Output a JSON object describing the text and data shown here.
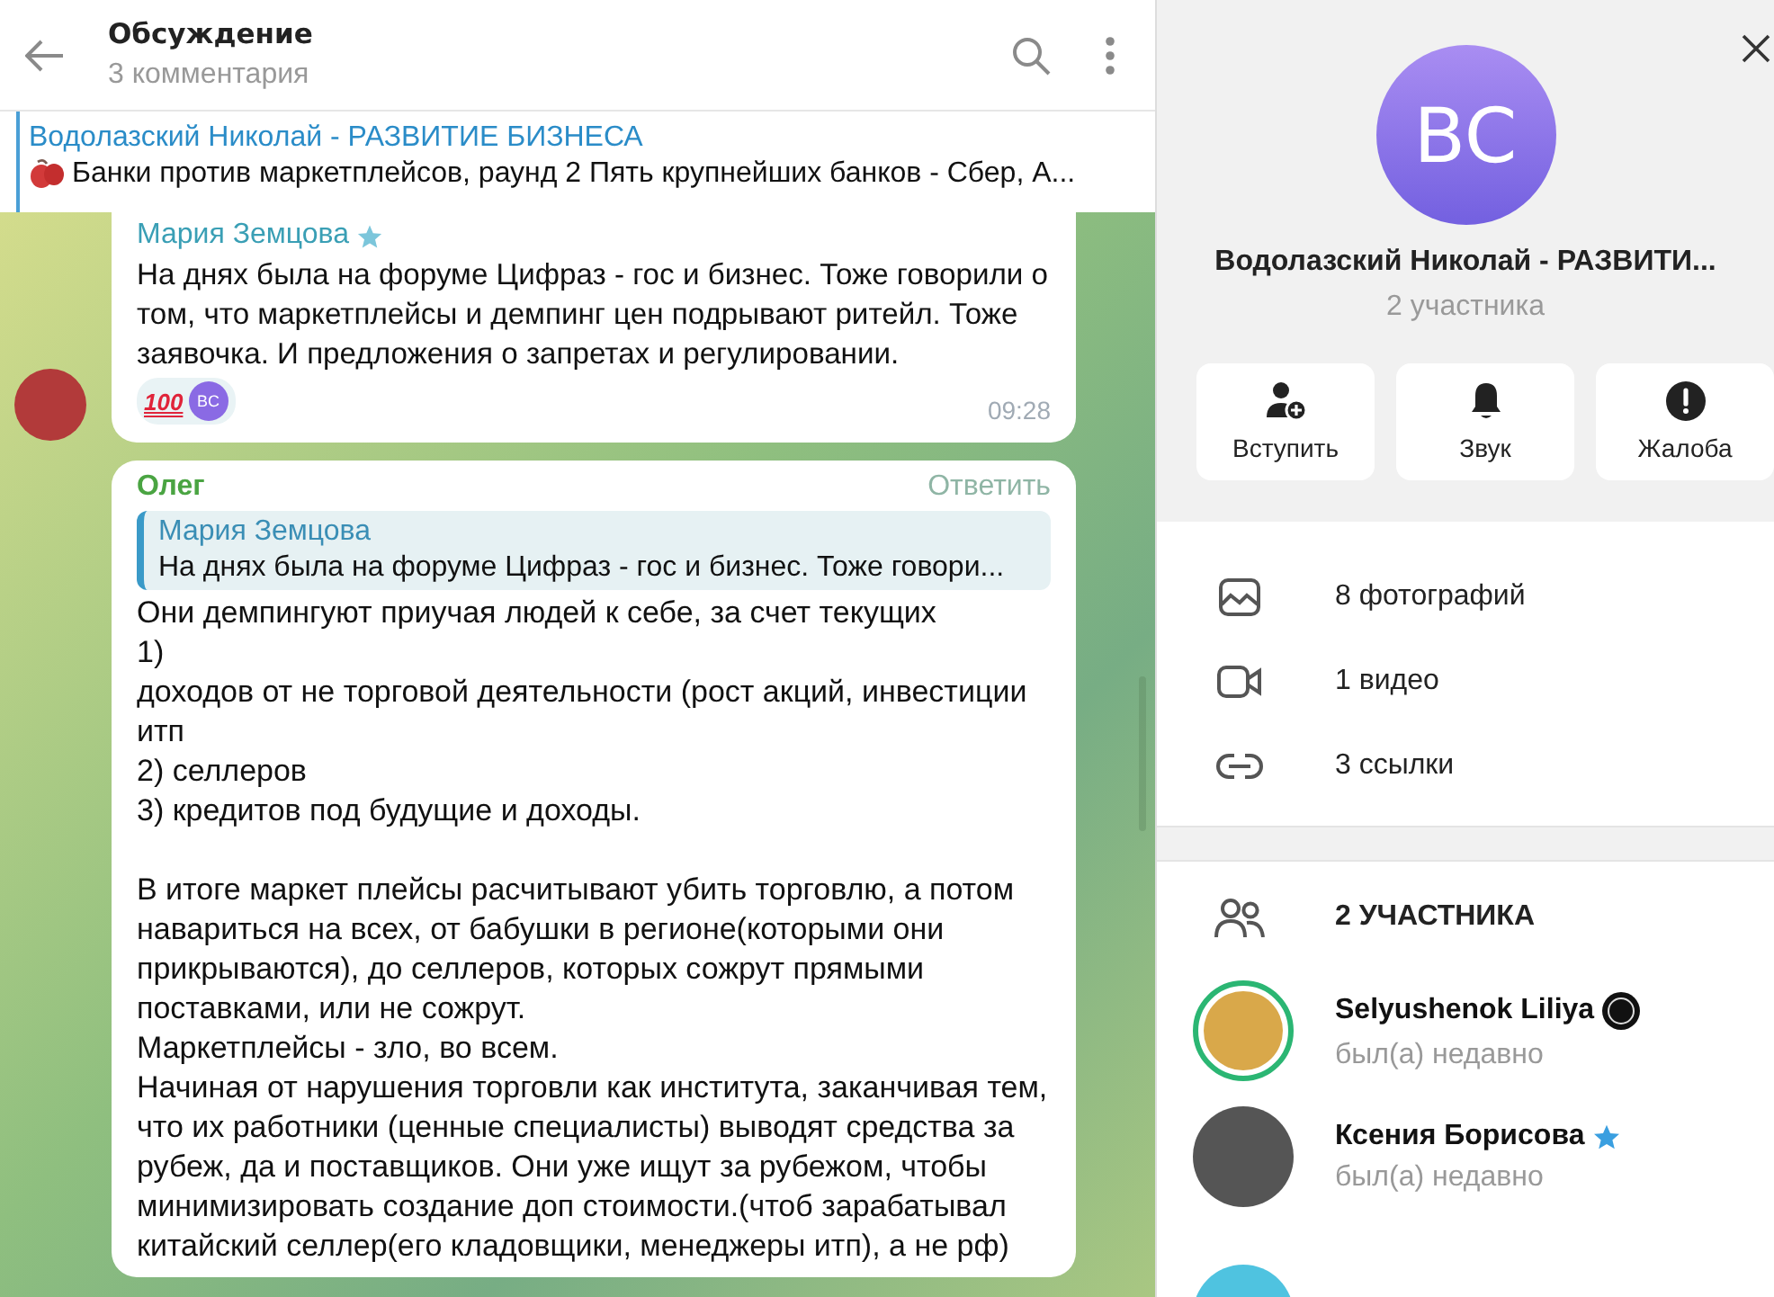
{
  "header": {
    "title": "Обсуждение",
    "subtitle": "3 комментария"
  },
  "pinned": {
    "title": "Водолазский Николай - РАЗВИТИЕ БИЗНЕСА",
    "text": "Банки против маркетплейсов, раунд 2  Пять крупнейших банков - Сбер, А..."
  },
  "messages": [
    {
      "author": "Мария Земцова",
      "has_star": true,
      "show_avatar": true,
      "text": "На днях была на форуме Цифраз - гос и бизнес. Тоже говорили о том, что маркетплейсы и демпинг цен подрывают ритейл. Тоже заявочка. И предложения о запретах и регулировании.",
      "reaction": {
        "label": "100",
        "user_initials": "BC"
      },
      "time": "09:28"
    },
    {
      "author": "Олег",
      "has_star": false,
      "action": "Ответить",
      "show_avatar": false,
      "reply": {
        "author": "Мария Земцова",
        "text": "На днях была на форуме Цифраз - гос и бизнес. Тоже говори..."
      },
      "text": "Они демпингуют приучая людей к себе, за счет текущих\n1)\nдоходов от не торговой деятельности (рост акций, инвестиции итп\n2) селлеров\n3) кредитов под будущие и доходы.\n\nВ итоге маркет плейсы расчитывают убить торговлю, а потом навариться на всех, от бабушки в регионе(которыми они прикрываются), до селлеров, которых сожрут прямыми поставками, или не сожрут.\nМаркетплейсы - зло, во всем.\nНачиная от нарушения торговли как института, заканчивая тем, что их работники (ценные специалисты) выводят средства за рубеж, да и поставщиков. Они уже ищут за рубежом, чтобы минимизировать создание доп стоимости.(чтоб зарабатывал китайский селлер(его кладовщики, менеджеры итп), а не рф)"
    }
  ],
  "profile": {
    "initials": "BC",
    "name": "Водолазский Николай - РАЗВИТИ...",
    "subtitle": "2 участника",
    "actions": [
      {
        "kind": "join",
        "label": "Вступить"
      },
      {
        "kind": "sound",
        "label": "Звук"
      },
      {
        "kind": "report",
        "label": "Жалоба"
      }
    ],
    "media": [
      {
        "kind": "photos",
        "label": "8 фотографий"
      },
      {
        "kind": "video",
        "label": "1 видео"
      },
      {
        "kind": "links",
        "label": "3 ссылки"
      }
    ],
    "members_title": "2 УЧАСТНИКА",
    "members": [
      {
        "name": "Selyushenok Liliya",
        "has_badge": true,
        "has_star": false,
        "has_story": true,
        "status": "был(а) недавно"
      },
      {
        "name": "Ксения Борисова",
        "has_badge": false,
        "has_star": true,
        "has_story": false,
        "status": "был(а) недавно"
      }
    ]
  }
}
